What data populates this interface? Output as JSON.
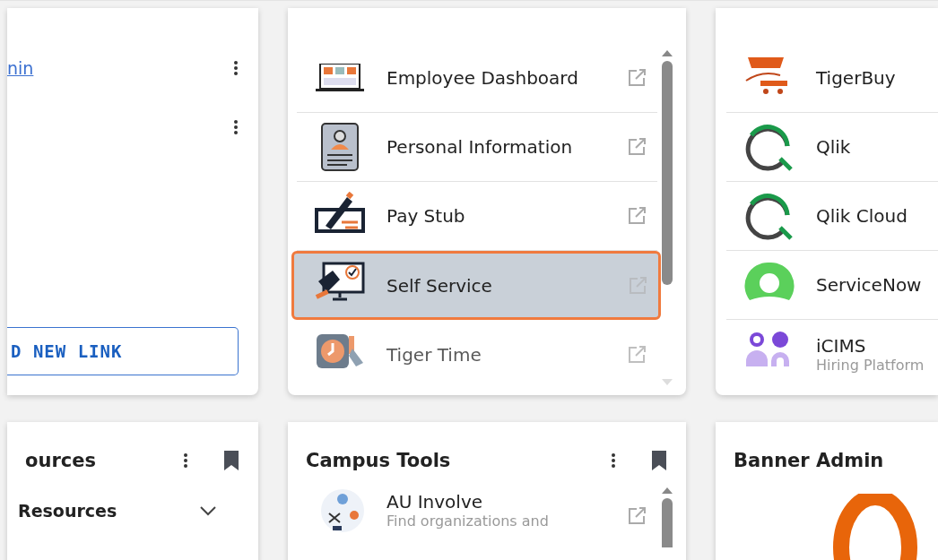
{
  "quick_links": {
    "rows": [
      {
        "kind": "link",
        "label": "nin"
      },
      {
        "kind": "blank"
      }
    ],
    "add_button": "D NEW LINK"
  },
  "employee_services": {
    "items": [
      {
        "label": "Employee Dashboard",
        "selected": false
      },
      {
        "label": "Personal Information",
        "selected": false
      },
      {
        "label": "Pay Stub",
        "selected": false
      },
      {
        "label": "Self Service",
        "selected": true
      },
      {
        "label": "Tiger Time",
        "selected": false
      }
    ]
  },
  "administrative_services": {
    "items": [
      {
        "label": "TigerBuy"
      },
      {
        "label": "Qlik"
      },
      {
        "label": "Qlik Cloud"
      },
      {
        "label": "ServiceNow"
      },
      {
        "label": "iCIMS",
        "subtitle": "Hiring Platform"
      }
    ]
  },
  "resources": {
    "title": "ources",
    "sections": [
      {
        "label": "Resources",
        "expanded": false
      }
    ]
  },
  "campus_tools": {
    "title": "Campus Tools",
    "items": [
      {
        "label": "AU Involve",
        "subtitle": "Find organizations and"
      }
    ]
  },
  "banner_admin": {
    "title": "Banner Admin"
  }
}
